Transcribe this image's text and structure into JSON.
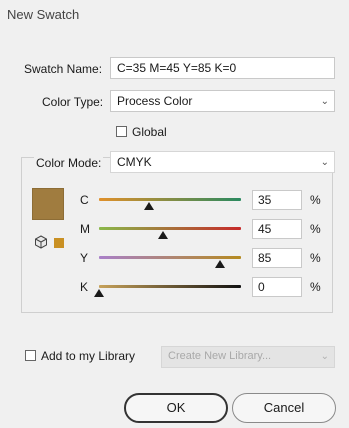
{
  "dialog": {
    "title": "New Swatch"
  },
  "swatch_name": {
    "label": "Swatch Name:",
    "value": "C=35 M=45 Y=85 K=0"
  },
  "color_type": {
    "label": "Color Type:",
    "value": "Process Color"
  },
  "global": {
    "label": "Global",
    "checked": false
  },
  "color_mode": {
    "label": "Color Mode:",
    "value": "CMYK"
  },
  "channels": [
    {
      "name": "C",
      "value": "35",
      "unit": "%",
      "fraction": 0.35,
      "gradient": [
        "#e0902a",
        "#2a8a60"
      ]
    },
    {
      "name": "M",
      "value": "45",
      "unit": "%",
      "fraction": 0.45,
      "gradient": [
        "#8ab84a",
        "#c62a2a"
      ]
    },
    {
      "name": "Y",
      "value": "85",
      "unit": "%",
      "fraction": 0.85,
      "gradient": [
        "#a980c9",
        "#b58a20"
      ]
    },
    {
      "name": "K",
      "value": "0",
      "unit": "%",
      "fraction": 0.0,
      "gradient": [
        "#c7a25a",
        "#111111"
      ]
    }
  ],
  "swatch_color": "#a07c3f",
  "library": {
    "label": "Add to my Library",
    "checked": false,
    "select_value": "Create New Library..."
  },
  "buttons": {
    "ok": "OK",
    "cancel": "Cancel"
  },
  "icons": {
    "select_chevron": "chevron-down-icon",
    "out_of_gamut": "cube-icon"
  }
}
